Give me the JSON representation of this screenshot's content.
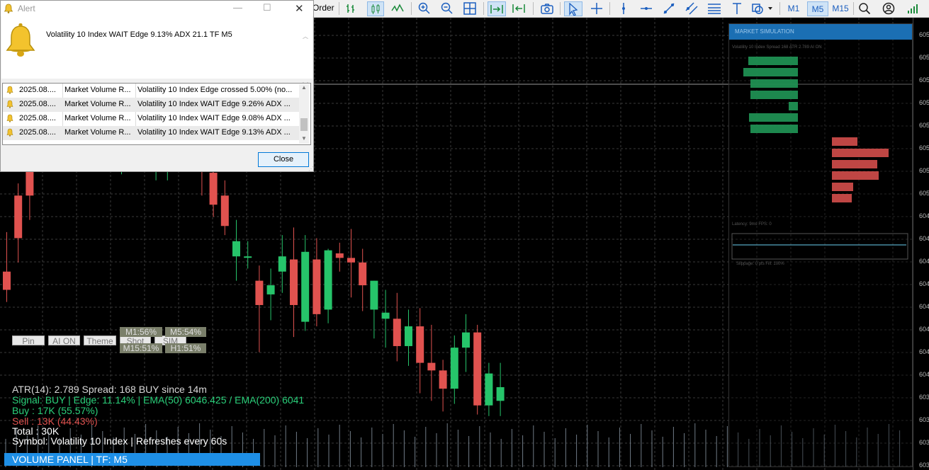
{
  "toolbar": {
    "order_label": "Order",
    "timeframes": [
      "M1",
      "M5",
      "M15"
    ],
    "active_timeframe": "M5",
    "icons": [
      "bar-chart-icon",
      "candlestick-icon",
      "line-chart-icon",
      "zoom-in-icon",
      "zoom-out-icon",
      "grid-icon",
      "autoscroll-icon",
      "chart-shift-icon",
      "screenshot-icon",
      "cursor-icon",
      "crosshair-icon",
      "vertical-line-icon",
      "horizontal-line-icon",
      "trendline-icon",
      "channel-icon",
      "fibonacci-icon",
      "text-icon",
      "shapes-icon",
      "search-icon",
      "account-icon",
      "signal-level-icon"
    ]
  },
  "alert": {
    "title": "Alert",
    "message": "Volatility 10 Index WAIT  Edge 9.13% ADX 21.1 TF M5",
    "rows": [
      {
        "time": "2025.08....",
        "source": "Market Volume R...",
        "text": "Volatility 10 Index Edge crossed 5.00% (no..."
      },
      {
        "time": "2025.08....",
        "source": "Market Volume R...",
        "text": "Volatility 10 Index WAIT  Edge 9.26% ADX ..."
      },
      {
        "time": "2025.08....",
        "source": "Market Volume R...",
        "text": "Volatility 10 Index WAIT  Edge 9.08% ADX ..."
      },
      {
        "time": "2025.08....",
        "source": "Market Volume R...",
        "text": "Volatility 10 Index WAIT  Edge 9.13% ADX ..."
      }
    ],
    "close_label": "Close"
  },
  "panel": {
    "buttons": [
      "Pin",
      "AI ON",
      "Theme",
      "Shot",
      "SIM"
    ],
    "tf_boxes": {
      "m1": "M1:56%",
      "m5": "M5:54%",
      "m15": "M15:51%",
      "h1": "H1:51%"
    },
    "atr_line": "ATR(14): 2.789   Spread: 168   BUY since 14m",
    "signal_line": "Signal: BUY  | Edge: 11.14%  | EMA(50) 6046.425 / EMA(200) 6041",
    "buy_line": "Buy   : 17K  (55.57%)",
    "sell_line": "Sell  : 13K  (44.43%)",
    "total_line": "Total : 30K",
    "symbol_line": "Symbol: Volatility 10 Index  |  Refreshes every 60s",
    "volume_bar": "VOLUME PANEL  |  TF: M5"
  },
  "sim": {
    "title": "MARKET SIMULATION",
    "subtitle": "Volatility 10 Index  Spread 168  ATR 2.789  AI ON",
    "latency": "Latency: 9ms  FPS: 0",
    "footer": "Slippage: 0 pts  Fill: 100%"
  },
  "price_labels": [
    "605",
    "605",
    "605",
    "605",
    "605",
    "605",
    "605",
    "605",
    "604",
    "604",
    "604",
    "604",
    "604",
    "604",
    "604",
    "604",
    "603",
    "603",
    "603",
    "603"
  ],
  "colors": {
    "bull": "#26c46a",
    "bear": "#e0524f",
    "grid": "#3a3a3a",
    "accent": "#1e8fe6"
  },
  "chart_data": {
    "type": "candlestick",
    "symbol": "Volatility 10 Index",
    "timeframe": "M5",
    "candles": [
      {
        "o": 6047.0,
        "h": 6049.6,
        "l": 6045.0,
        "c": 6045.8
      },
      {
        "o": 6052.0,
        "h": 6052.8,
        "l": 6047.6,
        "c": 6049.2
      },
      {
        "o": 6054.6,
        "h": 6055.2,
        "l": 6050.4,
        "c": 6052.0
      },
      {
        "o": 6057.4,
        "h": 6059.6,
        "l": 6056.8,
        "c": 6055.6
      },
      {
        "o": 6057.6,
        "h": 6059.2,
        "l": 6055.2,
        "c": 6058.8
      },
      {
        "o": 6058.6,
        "h": 6058.9,
        "l": 6057.0,
        "c": 6057.6
      },
      {
        "o": 6057.6,
        "h": 6059.3,
        "l": 6056.6,
        "c": 6056.8
      },
      {
        "o": 6056.0,
        "h": 6060.1,
        "l": 6055.2,
        "c": 6056.9
      },
      {
        "o": 6059.6,
        "h": 6060.3,
        "l": 6056.6,
        "c": 6058.4
      },
      {
        "o": 6058.8,
        "h": 6059.2,
        "l": 6056.6,
        "c": 6058.5
      },
      {
        "o": 6057.6,
        "h": 6058.3,
        "l": 6053.4,
        "c": 6058.6
      },
      {
        "o": 6058.0,
        "h": 6058.8,
        "l": 6055.7,
        "c": 6057.1
      },
      {
        "o": 6058.6,
        "h": 6061.6,
        "l": 6056.0,
        "c": 6058.0
      },
      {
        "o": 6055.0,
        "h": 6055.9,
        "l": 6053.0,
        "c": 6055.0
      },
      {
        "o": 6055.0,
        "h": 6060.4,
        "l": 6053.0,
        "c": 6058.0
      },
      {
        "o": 6059.0,
        "h": 6060.0,
        "l": 6056.0,
        "c": 6057.2
      },
      {
        "o": 6055.9,
        "h": 6059.0,
        "l": 6054.0,
        "c": 6057.0
      },
      {
        "o": 6055.0,
        "h": 6056.3,
        "l": 6052.0,
        "c": 6053.9
      },
      {
        "o": 6053.5,
        "h": 6054.5,
        "l": 6050.6,
        "c": 6051.4
      },
      {
        "o": 6052.0,
        "h": 6053.0,
        "l": 6049.4,
        "c": 6050.0
      },
      {
        "o": 6048.0,
        "h": 6050.4,
        "l": 6046.4,
        "c": 6049.0
      },
      {
        "o": 6048.0,
        "h": 6049.0,
        "l": 6047.2,
        "c": 6048.0
      },
      {
        "o": 6046.4,
        "h": 6047.4,
        "l": 6041.7,
        "c": 6044.8
      },
      {
        "o": 6045.5,
        "h": 6047.2,
        "l": 6043.8,
        "c": 6046.1
      },
      {
        "o": 6047.0,
        "h": 6049.4,
        "l": 6045.6,
        "c": 6048.0
      },
      {
        "o": 6047.8,
        "h": 6049.9,
        "l": 6042.7,
        "c": 6044.8
      },
      {
        "o": 6043.7,
        "h": 6049.4,
        "l": 6043.1,
        "c": 6048.3
      },
      {
        "o": 6047.8,
        "h": 6049.2,
        "l": 6043.4,
        "c": 6044.2
      },
      {
        "o": 6044.5,
        "h": 6048.5,
        "l": 6043.6,
        "c": 6048.4
      },
      {
        "o": 6048.2,
        "h": 6048.9,
        "l": 6047.0,
        "c": 6047.9
      },
      {
        "o": 6047.9,
        "h": 6049.8,
        "l": 6045.3,
        "c": 6047.6
      },
      {
        "o": 6047.6,
        "h": 6048.5,
        "l": 6044.4,
        "c": 6046.1
      },
      {
        "o": 6044.5,
        "h": 6046.4,
        "l": 6042.6,
        "c": 6046.4
      },
      {
        "o": 6043.9,
        "h": 6045.8,
        "l": 6042.0,
        "c": 6044.3
      },
      {
        "o": 6043.9,
        "h": 6045.6,
        "l": 6041.1,
        "c": 6042.1
      },
      {
        "o": 6042.1,
        "h": 6044.5,
        "l": 6040.8,
        "c": 6043.4
      },
      {
        "o": 6043.4,
        "h": 6044.6,
        "l": 6039.0,
        "c": 6041.0
      },
      {
        "o": 6041.0,
        "h": 6043.5,
        "l": 6038.5,
        "c": 6040.5
      },
      {
        "o": 6040.5,
        "h": 6041.2,
        "l": 6037.8,
        "c": 6039.3
      },
      {
        "o": 6039.3,
        "h": 6042.8,
        "l": 6038.3,
        "c": 6042.0
      },
      {
        "o": 6042.0,
        "h": 6044.2,
        "l": 6040.4,
        "c": 6043.0
      },
      {
        "o": 6043.0,
        "h": 6043.5,
        "l": 6037.6,
        "c": 6038.2
      },
      {
        "o": 6038.2,
        "h": 6041.0,
        "l": 6037.5,
        "c": 6040.3
      },
      {
        "o": 6038.5,
        "h": 6041.0,
        "l": 6037.5,
        "c": 6039.4
      }
    ]
  }
}
